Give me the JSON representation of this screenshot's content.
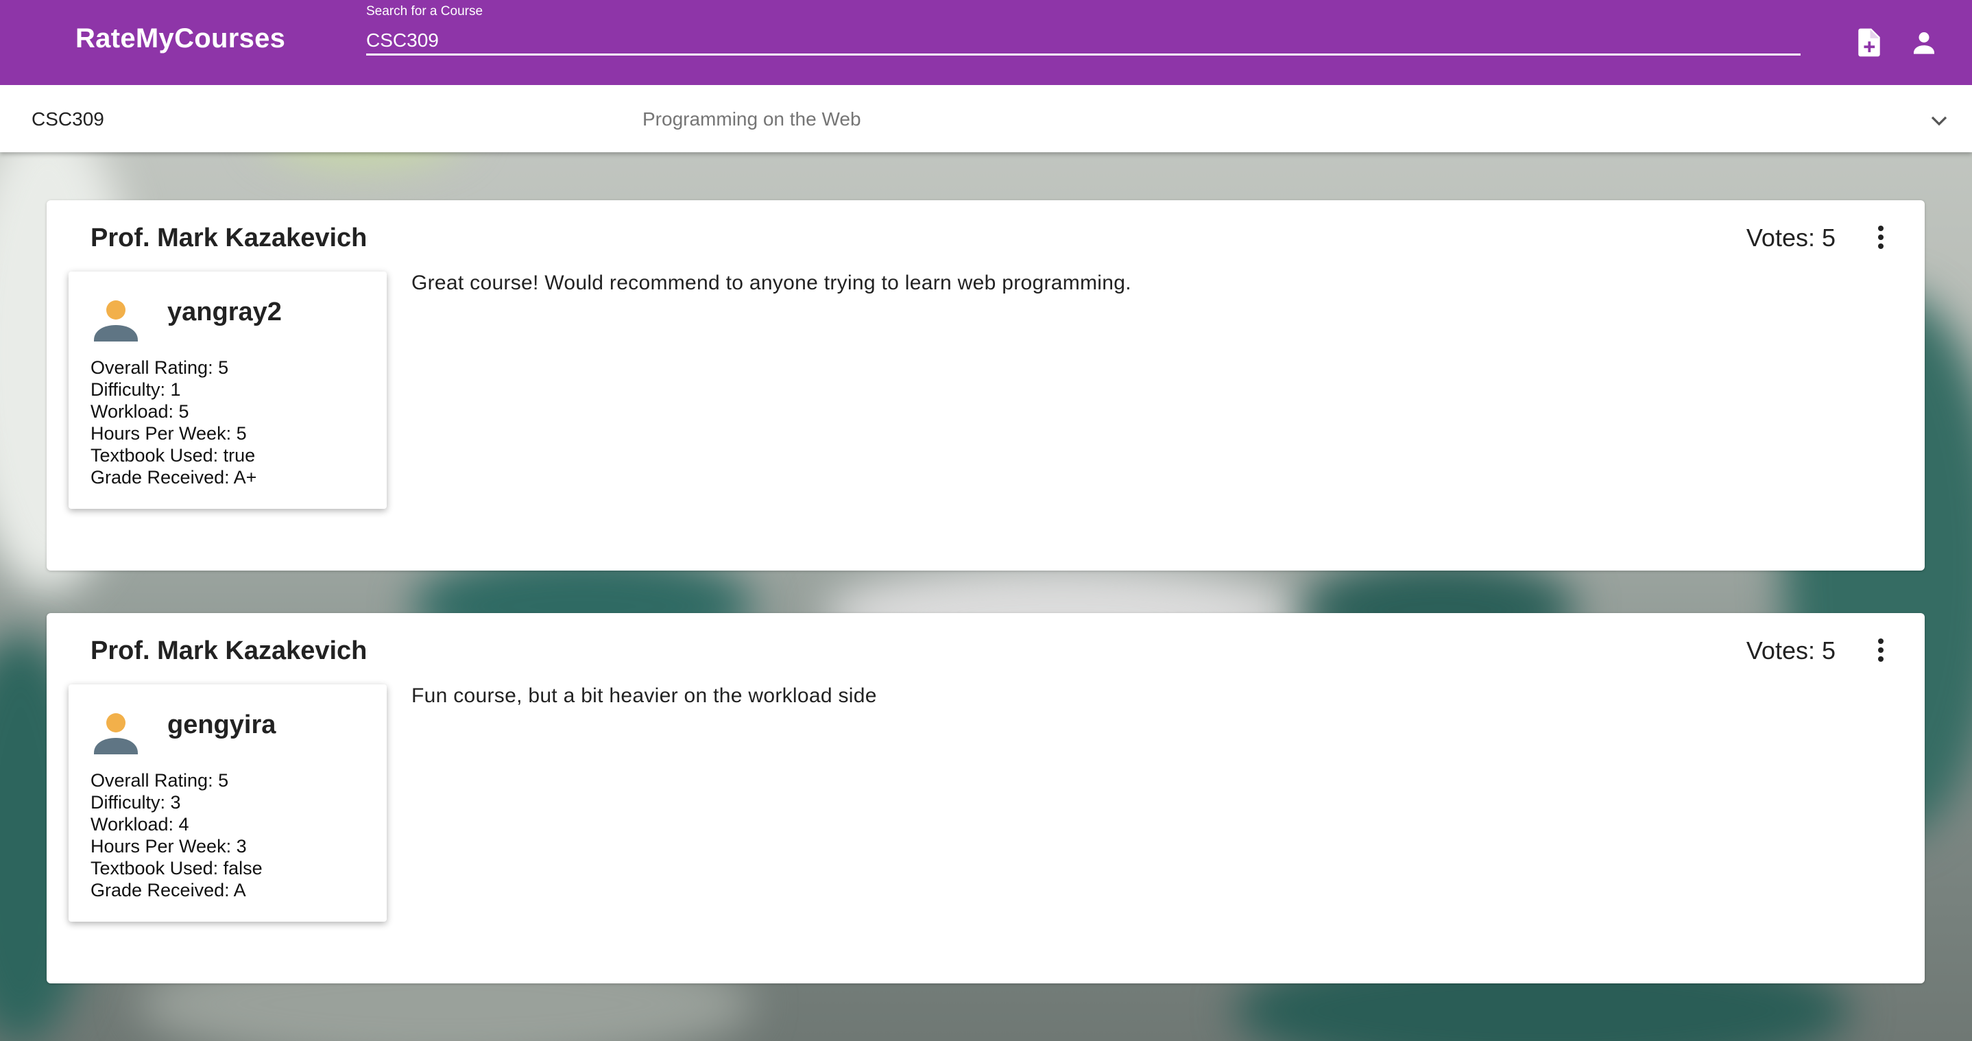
{
  "app": {
    "brand": "RateMyCourses"
  },
  "search": {
    "label": "Search for a Course",
    "value": "CSC309"
  },
  "header_icons": [
    "add-note-icon",
    "account-icon"
  ],
  "course": {
    "code": "CSC309",
    "name": "Programming on the Web"
  },
  "reviews": [
    {
      "professor": "Prof. Mark Kazakevich",
      "votes": "Votes: 5",
      "username": "yangray2",
      "stats": [
        "Overall Rating: 5",
        "Difficulty: 1",
        "Workload: 5",
        "Hours Per Week: 5",
        "Textbook Used: true",
        "Grade Received: A+"
      ],
      "comment": "Great course! Would recommend to anyone trying to learn web programming."
    },
    {
      "professor": "Prof. Mark Kazakevich",
      "votes": "Votes: 5",
      "username": "gengyira",
      "stats": [
        "Overall Rating: 5",
        "Difficulty: 3",
        "Workload: 4",
        "Hours Per Week: 3",
        "Textbook Used: false",
        "Grade Received: A"
      ],
      "comment": "Fun course, but a bit heavier on the workload side"
    }
  ],
  "colors": {
    "appbar": "#8e35a8",
    "avatar_head": "#f2b04a",
    "avatar_body": "#5f7584"
  }
}
